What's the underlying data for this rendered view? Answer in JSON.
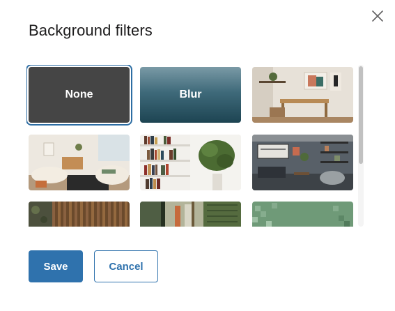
{
  "dialog": {
    "title": "Background filters",
    "close_icon": "close-icon"
  },
  "filters": [
    {
      "label": "None",
      "selected": true
    },
    {
      "label": "Blur",
      "selected": false
    },
    {
      "label": "",
      "description_icon": "office-image"
    },
    {
      "label": "",
      "description_icon": "living-room-image"
    },
    {
      "label": "",
      "description_icon": "bookshelf-image"
    },
    {
      "label": "",
      "description_icon": "lounge-image"
    },
    {
      "label": "",
      "description_icon": "wood-panel-image"
    },
    {
      "label": "",
      "description_icon": "green-doorway-image"
    },
    {
      "label": "",
      "description_icon": "green-pattern-image"
    }
  ],
  "actions": {
    "save_label": "Save",
    "cancel_label": "Cancel"
  },
  "colors": {
    "accent": "#2f72ad",
    "selected_ring": "#2d6da3",
    "none_tile": "#454545"
  }
}
